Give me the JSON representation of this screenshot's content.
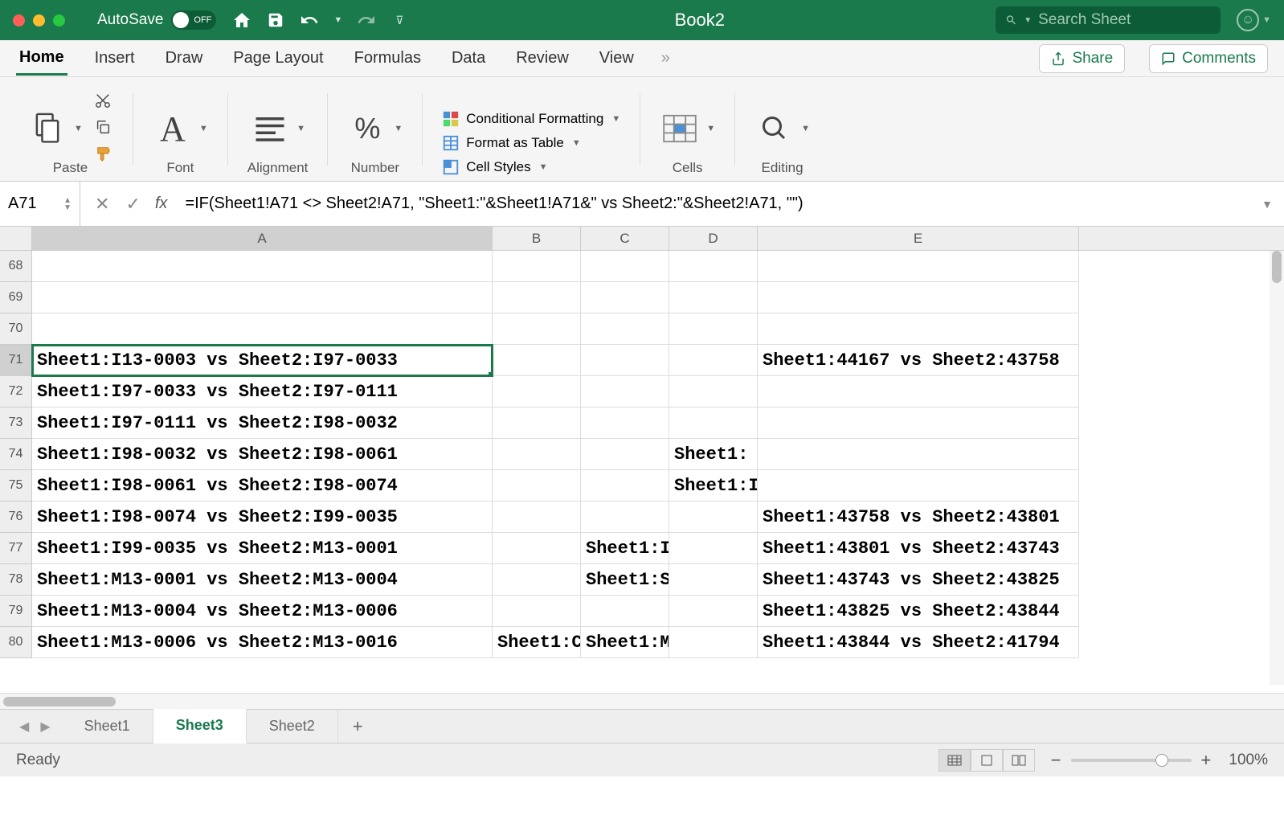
{
  "titlebar": {
    "autosave_label": "AutoSave",
    "autosave_state": "OFF",
    "document_title": "Book2",
    "search_placeholder": "Search Sheet"
  },
  "ribbon": {
    "tabs": [
      "Home",
      "Insert",
      "Draw",
      "Page Layout",
      "Formulas",
      "Data",
      "Review",
      "View"
    ],
    "active_tab": "Home",
    "share_label": "Share",
    "comments_label": "Comments",
    "groups": {
      "paste": "Paste",
      "font": "Font",
      "alignment": "Alignment",
      "number": "Number",
      "cells": "Cells",
      "editing": "Editing"
    },
    "format_items": {
      "conditional": "Conditional Formatting",
      "table": "Format as Table",
      "cell_styles": "Cell Styles"
    }
  },
  "formula_bar": {
    "name_box": "A71",
    "formula": "=IF(Sheet1!A71 <> Sheet2!A71, \"Sheet1:\"&Sheet1!A71&\" vs Sheet2:\"&Sheet2!A71, \"\")"
  },
  "columns": [
    "A",
    "B",
    "C",
    "D",
    "E"
  ],
  "selected_cell": "A71",
  "rows": [
    {
      "num": 68,
      "A": "",
      "B": "",
      "C": "",
      "D": "",
      "E": ""
    },
    {
      "num": 69,
      "A": "",
      "B": "",
      "C": "",
      "D": "",
      "E": ""
    },
    {
      "num": 70,
      "A": "",
      "B": "",
      "C": "",
      "D": "",
      "E": ""
    },
    {
      "num": 71,
      "A": "Sheet1:I13-0003 vs Sheet2:I97-0033",
      "B": "",
      "C": "",
      "D": "",
      "E": "Sheet1:44167 vs Sheet2:43758"
    },
    {
      "num": 72,
      "A": "Sheet1:I97-0033 vs Sheet2:I97-0111",
      "B": "",
      "C": "",
      "D": "",
      "E": ""
    },
    {
      "num": 73,
      "A": "Sheet1:I97-0111 vs Sheet2:I98-0032",
      "B": "",
      "C": "",
      "D": "",
      "E": ""
    },
    {
      "num": 74,
      "A": "Sheet1:I98-0032 vs Sheet2:I98-0061",
      "B": "",
      "C": "",
      "D": "Sheet1:",
      "E": ""
    },
    {
      "num": 75,
      "A": "Sheet1:I98-0061 vs Sheet2:I98-0074",
      "B": "",
      "C": "",
      "D": "Sheet1:I",
      "E": ""
    },
    {
      "num": 76,
      "A": "Sheet1:I98-0074 vs Sheet2:I99-0035",
      "B": "",
      "C": "",
      "D": "",
      "E": "Sheet1:43758 vs Sheet2:43801"
    },
    {
      "num": 77,
      "A": "Sheet1:I99-0035 vs Sheet2:M13-0001",
      "B": "",
      "C": "Sheet1:I",
      "D": "",
      "E": "Sheet1:43801 vs Sheet2:43743"
    },
    {
      "num": 78,
      "A": "Sheet1:M13-0001 vs Sheet2:M13-0004",
      "B": "",
      "C": "Sheet1:S",
      "D": "",
      "E": "Sheet1:43743 vs Sheet2:43825"
    },
    {
      "num": 79,
      "A": "Sheet1:M13-0004 vs Sheet2:M13-0006",
      "B": "",
      "C": "",
      "D": "",
      "E": "Sheet1:43825 vs Sheet2:43844"
    },
    {
      "num": 80,
      "A": "Sheet1:M13-0006 vs Sheet2:M13-0016",
      "B": "Sheet1:C",
      "C": "Sheet1:M",
      "D": "",
      "E": "Sheet1:43844 vs Sheet2:41794"
    }
  ],
  "sheet_tabs": [
    "Sheet1",
    "Sheet3",
    "Sheet2"
  ],
  "active_sheet": "Sheet3",
  "status": {
    "ready": "Ready",
    "zoom": "100%"
  }
}
